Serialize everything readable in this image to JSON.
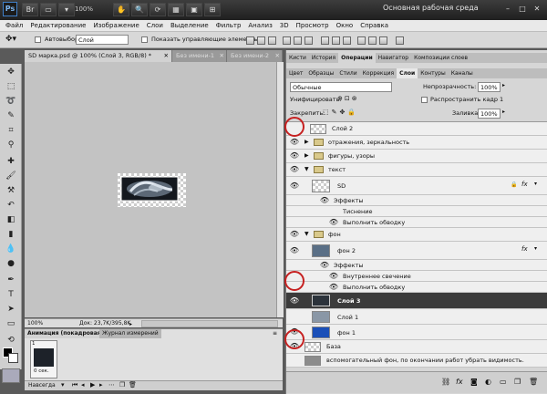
{
  "title_bar": {
    "logo": "Ps",
    "zoom": "100%",
    "workspace": "Основная рабочая среда",
    "icons": [
      "file-icon",
      "mini-bridge-icon",
      "hand-icon",
      "zoom-icon",
      "rotate-icon",
      "grid-icon",
      "screen-mode-icon",
      "arrange-icon"
    ]
  },
  "menu": [
    "Файл",
    "Редактирование",
    "Изображение",
    "Слои",
    "Выделение",
    "Фильтр",
    "Анализ",
    "3D",
    "Просмотр",
    "Окно",
    "Справка"
  ],
  "options": {
    "autoselect_label": "Автовыбор:",
    "autoselect_value": "Слой",
    "show_controls_label": "Показать управляющие элементы"
  },
  "document": {
    "tabs": [
      "SD марка.psd @ 100% (Слой 3, RGB/8) *",
      "Без имени-1",
      "Без имени-2"
    ],
    "zoom": "100%",
    "doc_info": "Док: 23,7K/395,8K"
  },
  "animation": {
    "tabs": [
      "Анимация (покадровая)",
      "Журнал измерений"
    ],
    "frame_number": "1",
    "frame_delay": "0 сек.",
    "loop": "Навсегда"
  },
  "panels": {
    "tabs_row1": [
      "Кисти",
      "История",
      "Операции",
      "Навигатор",
      "Композиции слоев"
    ],
    "tabs_row2": [
      "Цвет",
      "Образцы",
      "Стили",
      "Коррекция",
      "Слои",
      "Контуры",
      "Каналы"
    ],
    "blend_mode": "Обычные",
    "opacity_label": "Непрозрачность:",
    "opacity_value": "100%",
    "unify_label": "Унифицировать:",
    "propagate_label": "Распространить кадр 1",
    "lock_label": "Закрепить:",
    "fill_label": "Заливка:",
    "fill_value": "100%"
  },
  "layers": [
    {
      "name": "Слой 2"
    },
    {
      "name": "отражения, зеркальность"
    },
    {
      "name": "фигуры, узоры"
    },
    {
      "name": "текст"
    },
    {
      "name": "SD"
    },
    {
      "name": "Эффекты"
    },
    {
      "name": "Тиснение"
    },
    {
      "name": "Выполнить обводку"
    },
    {
      "name": "фон"
    },
    {
      "name": "фон 2"
    },
    {
      "name": "Эффекты"
    },
    {
      "name": "Внутреннее свечение"
    },
    {
      "name": "Выполнить обводку"
    },
    {
      "name": "Слой 3"
    },
    {
      "name": "Слой 1"
    },
    {
      "name": "фон 1"
    },
    {
      "name": "База"
    },
    {
      "name": "вспомогательный фон, по окончании работ убрать видимость."
    }
  ],
  "colors": {
    "selected_layer": "#3b3b3b",
    "highlight_circle": "#c62121",
    "canvas": "#c3c3c3"
  }
}
